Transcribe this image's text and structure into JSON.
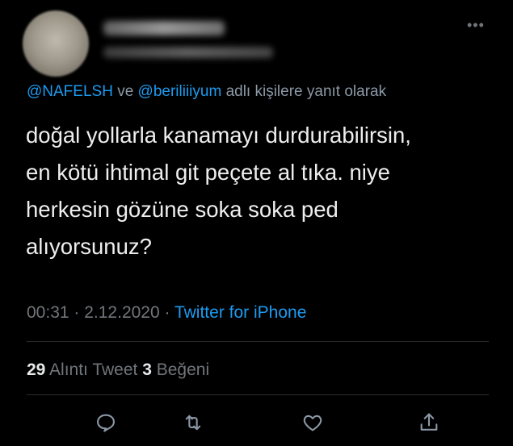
{
  "reply_line": {
    "mention1": "@NAFELSH",
    "conj": " ve ",
    "mention2": "@beriliiiyum",
    "suffix": " adlı kişilere yanıt olarak"
  },
  "tweet_lines": [
    "doğal yollarla kanamayı durdurabilirsin,",
    "en kötü ihtimal git peçete al tıka. niye",
    "herkesin gözüne soka soka ped",
    "alıyorsunuz?"
  ],
  "meta": {
    "time": "00:31",
    "sep1": " · ",
    "date": "2.12.2020",
    "sep2": " · ",
    "source": "Twitter for iPhone"
  },
  "stats": {
    "quote_count": "29",
    "quote_label": " Alıntı Tweet  ",
    "like_count": "3",
    "like_label": " Beğeni"
  },
  "icons": [
    "more-icon",
    "reply-icon",
    "retweet-icon",
    "like-icon",
    "share-icon"
  ],
  "colors": {
    "background": "#000000",
    "link": "#1d9bf0",
    "muted": "#71767b",
    "text": "#eeeeee"
  }
}
